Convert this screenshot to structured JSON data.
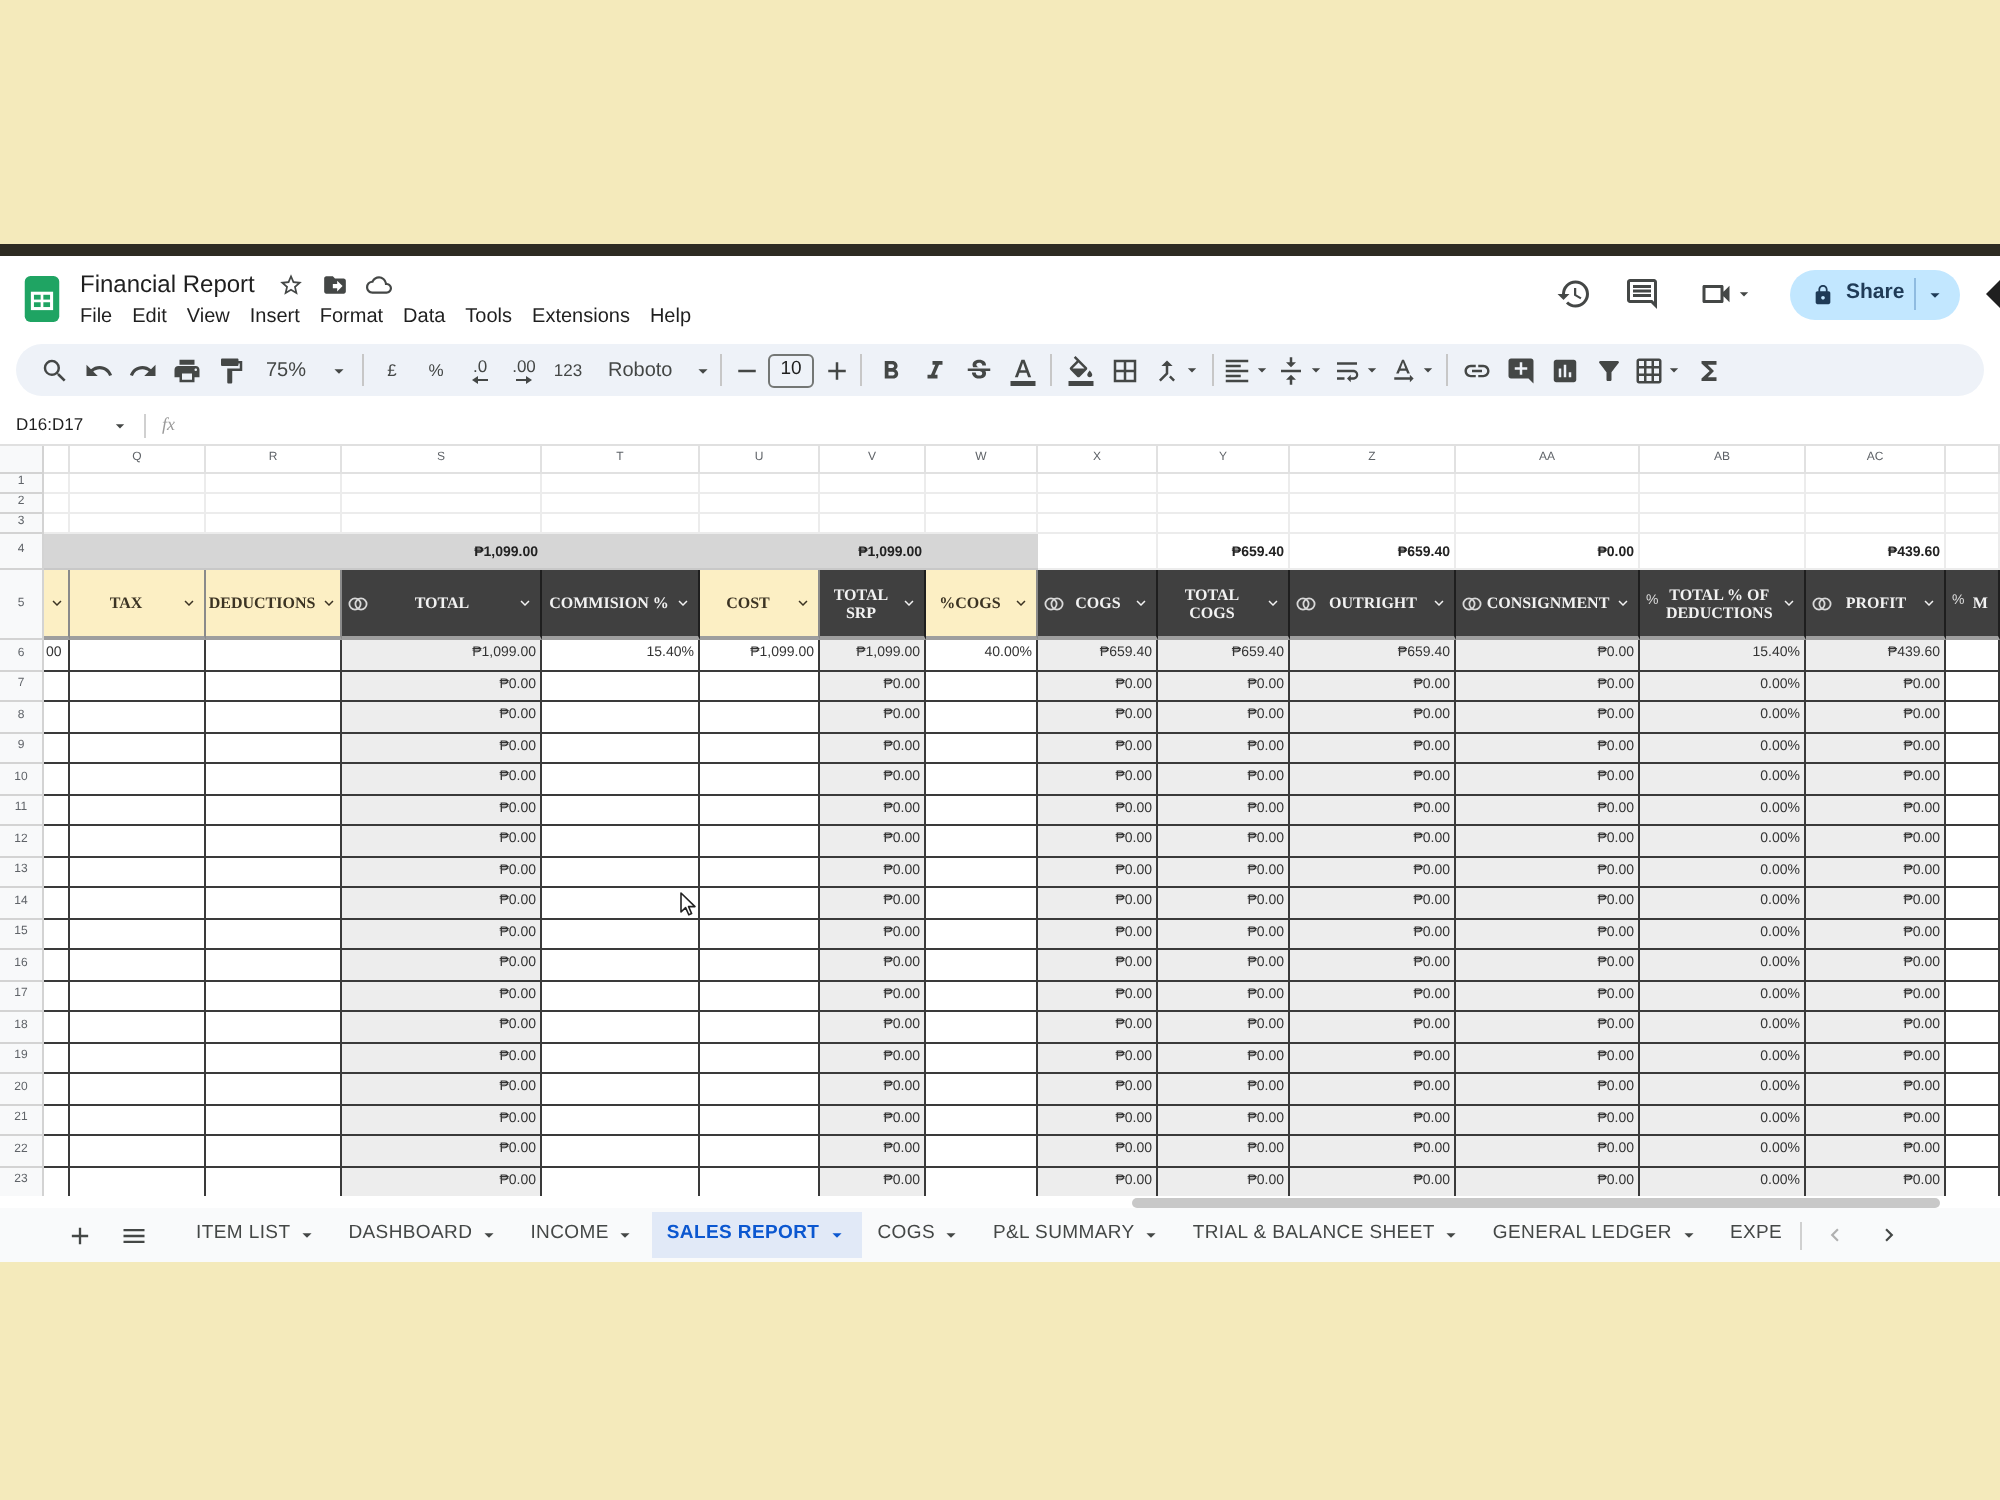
{
  "document": {
    "title": "Financial Report",
    "menu": [
      "File",
      "Edit",
      "View",
      "Insert",
      "Format",
      "Data",
      "Tools",
      "Extensions",
      "Help"
    ]
  },
  "share_button": {
    "label": "Share"
  },
  "toolbar": {
    "zoom": "75%",
    "number_formats": [
      {
        "kind": "symbol",
        "label": "£"
      },
      {
        "kind": "symbol",
        "label": "%"
      },
      {
        "kind": "decrease",
        "label": ".0"
      },
      {
        "kind": "increase",
        "label": ".00"
      },
      {
        "kind": "symbol",
        "label": "123"
      }
    ],
    "font": "Roboto",
    "font_size": "10"
  },
  "formula_bar": {
    "name_box": "D16:D17",
    "fx_label": "fx"
  },
  "sheet": {
    "row_numbers": [
      "1",
      "2",
      "3",
      "4",
      "5",
      "6",
      "7",
      "8",
      "9",
      "10",
      "11",
      "12",
      "13",
      "14",
      "15",
      "16",
      "17",
      "18",
      "19",
      "20",
      "21",
      "22",
      "23"
    ],
    "columns": [
      {
        "kind": "light",
        "shaded": false,
        "dropdown": true,
        "values": [
          "00"
        ]
      },
      {
        "kind": "light",
        "letter": "Q",
        "header": "TAX",
        "shaded": false,
        "dropdown": true
      },
      {
        "kind": "light",
        "letter": "R",
        "header": "DEDUCTIONS",
        "shaded": false,
        "dropdown": true
      },
      {
        "kind": "currency",
        "letter": "S",
        "header": "TOTAL",
        "shaded": true,
        "dropdown": true,
        "summary": "₱1,099.00",
        "values": [
          "₱1,099.00",
          "₱0.00",
          "₱0.00",
          "₱0.00",
          "₱0.00",
          "₱0.00",
          "₱0.00",
          "₱0.00",
          "₱0.00",
          "₱0.00",
          "₱0.00",
          "₱0.00",
          "₱0.00",
          "₱0.00",
          "₱0.00",
          "₱0.00",
          "₱0.00",
          "₱0.00"
        ]
      },
      {
        "kind": "dark",
        "letter": "T",
        "header": "COMMISION %",
        "shaded": false,
        "dropdown": true,
        "values": [
          "15.40%"
        ]
      },
      {
        "kind": "light",
        "letter": "U",
        "header": "COST",
        "shaded": false,
        "dropdown": true,
        "values": [
          "₱1,099.00"
        ]
      },
      {
        "kind": "dark",
        "letter": "V",
        "header": "TOTAL SRP",
        "shaded": true,
        "dropdown": true,
        "summary": "₱1,099.00",
        "values": [
          "₱1,099.00",
          "₱0.00",
          "₱0.00",
          "₱0.00",
          "₱0.00",
          "₱0.00",
          "₱0.00",
          "₱0.00",
          "₱0.00",
          "₱0.00",
          "₱0.00",
          "₱0.00",
          "₱0.00",
          "₱0.00",
          "₱0.00",
          "₱0.00",
          "₱0.00",
          "₱0.00"
        ]
      },
      {
        "kind": "light",
        "letter": "W",
        "header": "%COGS",
        "shaded": false,
        "dropdown": true,
        "values": [
          "40.00%"
        ]
      },
      {
        "kind": "currency",
        "letter": "X",
        "header": "COGS",
        "shaded": true,
        "dropdown": true,
        "values": [
          "₱659.40",
          "₱0.00",
          "₱0.00",
          "₱0.00",
          "₱0.00",
          "₱0.00",
          "₱0.00",
          "₱0.00",
          "₱0.00",
          "₱0.00",
          "₱0.00",
          "₱0.00",
          "₱0.00",
          "₱0.00",
          "₱0.00",
          "₱0.00",
          "₱0.00",
          "₱0.00"
        ]
      },
      {
        "kind": "dark",
        "letter": "Y",
        "header": "TOTAL COGS",
        "shaded": true,
        "dropdown": true,
        "summary": "₱659.40",
        "values": [
          "₱659.40",
          "₱0.00",
          "₱0.00",
          "₱0.00",
          "₱0.00",
          "₱0.00",
          "₱0.00",
          "₱0.00",
          "₱0.00",
          "₱0.00",
          "₱0.00",
          "₱0.00",
          "₱0.00",
          "₱0.00",
          "₱0.00",
          "₱0.00",
          "₱0.00",
          "₱0.00"
        ]
      },
      {
        "kind": "currency",
        "letter": "Z",
        "header": "OUTRIGHT",
        "shaded": true,
        "dropdown": true,
        "summary": "₱659.40",
        "values": [
          "₱659.40",
          "₱0.00",
          "₱0.00",
          "₱0.00",
          "₱0.00",
          "₱0.00",
          "₱0.00",
          "₱0.00",
          "₱0.00",
          "₱0.00",
          "₱0.00",
          "₱0.00",
          "₱0.00",
          "₱0.00",
          "₱0.00",
          "₱0.00",
          "₱0.00",
          "₱0.00"
        ]
      },
      {
        "kind": "currency",
        "letter": "AA",
        "header": "CONSIGNMENT",
        "shaded": true,
        "dropdown": true,
        "summary": "₱0.00",
        "values": [
          "₱0.00",
          "₱0.00",
          "₱0.00",
          "₱0.00",
          "₱0.00",
          "₱0.00",
          "₱0.00",
          "₱0.00",
          "₱0.00",
          "₱0.00",
          "₱0.00",
          "₱0.00",
          "₱0.00",
          "₱0.00",
          "₱0.00",
          "₱0.00",
          "₱0.00",
          "₱0.00"
        ]
      },
      {
        "kind": "percent",
        "type_mark": "%",
        "letter": "AB",
        "header": "TOTAL % OF DEDUCTIONS",
        "shaded": true,
        "dropdown": true,
        "values": [
          "15.40%",
          "0.00%",
          "0.00%",
          "0.00%",
          "0.00%",
          "0.00%",
          "0.00%",
          "0.00%",
          "0.00%",
          "0.00%",
          "0.00%",
          "0.00%",
          "0.00%",
          "0.00%",
          "0.00%",
          "0.00%",
          "0.00%",
          "0.00%"
        ]
      },
      {
        "kind": "currency",
        "letter": "AC",
        "header": "PROFIT",
        "shaded": true,
        "dropdown": true,
        "summary": "₱439.60",
        "values": [
          "₱439.60",
          "₱0.00",
          "₱0.00",
          "₱0.00",
          "₱0.00",
          "₱0.00",
          "₱0.00",
          "₱0.00",
          "₱0.00",
          "₱0.00",
          "₱0.00",
          "₱0.00",
          "₱0.00",
          "₱0.00",
          "₱0.00",
          "₱0.00",
          "₱0.00",
          "₱0.00"
        ]
      },
      {
        "kind": "percent",
        "type_mark": "%",
        "header": "M",
        "shaded": false,
        "dropdown": false
      }
    ]
  },
  "sheet_tabs": [
    {
      "label": "ITEM LIST",
      "selected": false,
      "dropdown": true
    },
    {
      "label": "DASHBOARD",
      "selected": false,
      "dropdown": true
    },
    {
      "label": "INCOME",
      "selected": false,
      "dropdown": true
    },
    {
      "label": "SALES REPORT",
      "selected": true,
      "dropdown": true
    },
    {
      "label": "COGS",
      "selected": false,
      "dropdown": true
    },
    {
      "label": "P&L SUMMARY",
      "selected": false,
      "dropdown": true
    },
    {
      "label": "TRIAL & BALANCE SHEET",
      "selected": false,
      "dropdown": true
    },
    {
      "label": "GENERAL LEDGER",
      "selected": false,
      "dropdown": true
    },
    {
      "label": "EXPE",
      "selected": false,
      "dropdown": false
    }
  ]
}
